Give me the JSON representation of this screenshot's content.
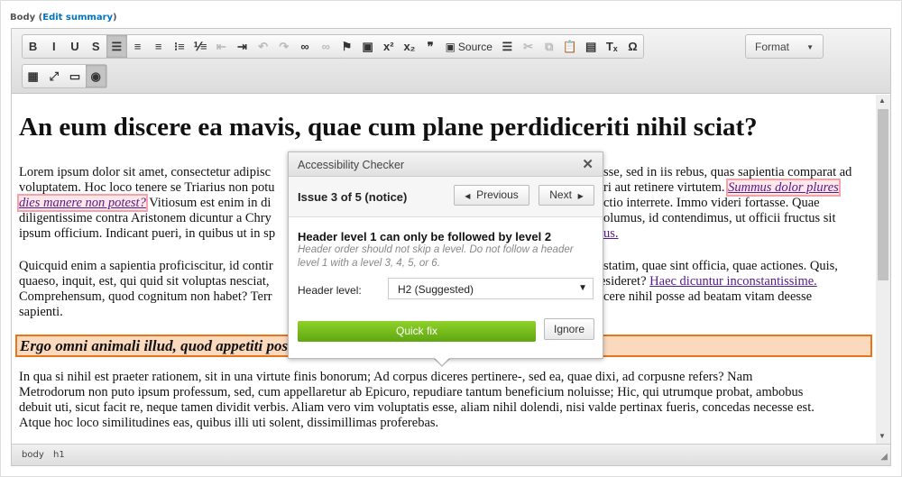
{
  "field": {
    "label": "Body",
    "edit_summary": "Edit summary"
  },
  "toolbar": {
    "row1": [
      {
        "name": "bold",
        "glyph": "B"
      },
      {
        "name": "italic",
        "glyph": "I"
      },
      {
        "name": "underline",
        "glyph": "U"
      },
      {
        "name": "strikethrough",
        "glyph": "S"
      },
      {
        "name": "align-left",
        "glyph": "☰",
        "active": true
      },
      {
        "name": "align-center",
        "glyph": "≡"
      },
      {
        "name": "align-right",
        "glyph": "≡"
      },
      {
        "name": "bulleted-list",
        "glyph": "⁝≡"
      },
      {
        "name": "numbered-list",
        "glyph": "⅟≡"
      },
      {
        "name": "outdent",
        "glyph": "⇤",
        "disabled": true
      },
      {
        "name": "indent",
        "glyph": "⇥"
      },
      {
        "name": "undo",
        "glyph": "↶",
        "disabled": true
      },
      {
        "name": "redo",
        "glyph": "↷",
        "disabled": true
      },
      {
        "name": "link",
        "glyph": "∞"
      },
      {
        "name": "unlink",
        "glyph": "∞",
        "disabled": true
      },
      {
        "name": "anchor-flag",
        "glyph": "⚑"
      },
      {
        "name": "image",
        "glyph": "▣"
      },
      {
        "name": "superscript",
        "glyph": "x²"
      },
      {
        "name": "subscript",
        "glyph": "x₂"
      },
      {
        "name": "blockquote",
        "glyph": "❞"
      }
    ],
    "source_label": "Source",
    "row1b": [
      {
        "name": "horizontal-rule",
        "glyph": "☰"
      },
      {
        "name": "cut",
        "glyph": "✂",
        "disabled": true
      },
      {
        "name": "copy",
        "glyph": "⧉",
        "disabled": true
      },
      {
        "name": "paste",
        "glyph": "📋"
      },
      {
        "name": "paste-from-word",
        "glyph": "▤"
      },
      {
        "name": "remove-format",
        "glyph": "Tₓ"
      },
      {
        "name": "special-character",
        "glyph": "Ω"
      }
    ],
    "format_label": "Format",
    "row2": [
      {
        "name": "table",
        "glyph": "▦"
      },
      {
        "name": "maximize",
        "glyph": "⤢"
      },
      {
        "name": "paragraph-template",
        "glyph": "▭"
      },
      {
        "name": "accessibility-checker",
        "glyph": "◉",
        "active": true
      }
    ]
  },
  "content": {
    "heading": "An eum discere ea mavis, quae cum plane perdidiceriti nihil sciat?",
    "p1": {
      "l1a": "Lorem ipsum dolor sit amet, consectetur adipisc",
      "l1b": "sse, sed in iis rebus, quas sapientia comparat ad",
      "l2a": "voluptatem. Hoc loco tenere se Triarius non potu",
      "l2b": "ri aut retinere virtutem. ",
      "l2link": "Summus dolor plures",
      "l3link": "dies manere non potest?",
      "l3a": " Vitiosum est enim in di",
      "l3b": "ctio interrete. Immo videri fortasse. Quae",
      "l4a": "diligentissime contra Aristonem dicuntur a Chry",
      "l4b": "olumus, id contendimus, ut officii fructus sit",
      "l5a": "ipsum officium. Indicant pueri, in quibus ut in sp",
      "l5link": "us."
    },
    "p2": {
      "l1a": "Quicquid enim a sapientia proficiscitur, id contir",
      "l1b": "statim, quae sint officia, quae actiones. Quis,",
      "l2a": "quaeso, inquit, est, qui quid sit voluptas nesciat,",
      "l2b": "esideret? ",
      "l2link": "Haec dicuntur inconstantissime.",
      "l3a": "Comprehensum, quod cognitum non habet? Terr",
      "l3b": "cere nihil posse ad beatam vitam deesse",
      "l4a": "sapienti."
    },
    "h2": "Ergo omni animali illud, quod appetiti positum est in eo, quod naturae est accommodatum.",
    "p3": [
      "In qua si nihil est praeter rationem, sit in una virtute finis bonorum; Ad corpus diceres pertinere-, sed ea, quae dixi, ad corpusne refers? Nam",
      "Metrodorum non puto ipsum professum, sed, cum appellaretur ab Epicuro, repudiare tantum beneficium noluisse; Hic, qui utrumque probat, ambobus",
      "debuit uti, sicut facit re, neque tamen dividit verbis. Aliam vero vim voluptatis esse, aliam nihil dolendi, nisi valde pertinax fueris, concedas necesse est.",
      "Atque hoc loco similitudines eas, quibus illi uti solent, dissimillimas proferebas."
    ]
  },
  "footer": {
    "path": [
      "body",
      "h1"
    ]
  },
  "checker": {
    "title": "Accessibility Checker",
    "issue": "Issue 3 of 5 (notice)",
    "previous": "Previous",
    "next": "Next",
    "message": "Header level 1 can only be followed by level 2",
    "description": "Header order should not skip a level. Do not follow a header level 1 with a level 3, 4, 5, or 6.",
    "header_level_label": "Header level:",
    "header_level_value": "H2 (Suggested)",
    "quick_fix": "Quick fix",
    "ignore": "Ignore"
  },
  "colors": {
    "quick_fix": "#6cb61a",
    "issue_highlight": "#e8741b",
    "link_highlight": "#f5a3a8",
    "link": "#551a8b"
  }
}
